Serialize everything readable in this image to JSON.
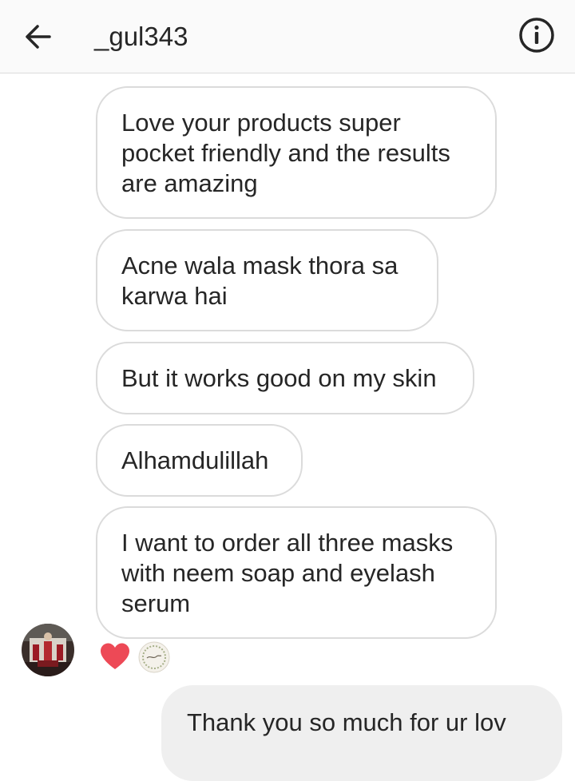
{
  "header": {
    "username": "_gul343",
    "back_icon": "arrow-left-icon",
    "info_icon": "info-circle-icon"
  },
  "messages": [
    {
      "text": "Love your products super\npocket friendly and the results\nare amazing"
    },
    {
      "text": "Acne wala mask thora sa\nkarwa hai"
    },
    {
      "text": "But it works good on my skin"
    },
    {
      "text": "Alhamdulillah"
    },
    {
      "text": "I want to order all three masks\nwith neem soap and eyelash\nserum"
    }
  ],
  "reaction": {
    "emoji_icon": "heart-icon",
    "color": "#ed4956"
  },
  "sent_message": {
    "text": "Thank you so much for ur lov"
  },
  "colors": {
    "header_bg": "#fafafa",
    "bubble_border": "#dbdbdb",
    "sent_bubble_bg": "#efefef",
    "text": "#262626"
  }
}
